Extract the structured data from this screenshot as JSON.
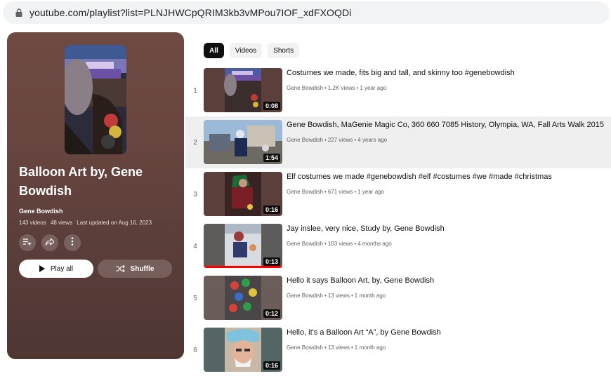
{
  "browser": {
    "url": "youtube.com/playlist?list=PLNJHWCpQRIM3kb3vMPou7IOF_xdFXOQDi"
  },
  "playlist": {
    "title": "Balloon Art by, Gene Bowdish",
    "owner": "Gene Bowdish",
    "video_count": "143 videos",
    "views": "48 views",
    "updated": "Last updated on Aug 16, 2023",
    "play_all_label": "Play all",
    "shuffle_label": "Shuffle"
  },
  "filters": [
    "All",
    "Videos",
    "Shorts"
  ],
  "videos": [
    {
      "index": "1",
      "title": "Costumes we made, fits big and tall, and skinny too #genebowdish",
      "channel": "Gene Bowdish",
      "views": "1.2K views",
      "age": "1 year ago",
      "duration": "0:08"
    },
    {
      "index": "2",
      "title": "Gene Bowdish, MaGenie Magic Co, 360 660 7085 History, Olympia, WA, Fall Arts Walk 2015",
      "channel": "Gene Bowdish",
      "views": "227 views",
      "age": "4 years ago",
      "duration": "1:54"
    },
    {
      "index": "3",
      "title": "Elf costumes we made #genebowdish #elf #costumes #we #made #christmas",
      "channel": "Gene Bowdish",
      "views": "671 views",
      "age": "1 year ago",
      "duration": "0:16"
    },
    {
      "index": "4",
      "title": "Jay inslee, very nice, Study by, Gene Bowdish",
      "channel": "Gene Bowdish",
      "views": "103 views",
      "age": "4 months ago",
      "duration": "0:13",
      "watched_fraction": 1.0
    },
    {
      "index": "5",
      "title": "Hello it says Balloon Art, by, Gene Bowdish",
      "channel": "Gene Bowdish",
      "views": "13 views",
      "age": "1 month ago",
      "duration": "0:12"
    },
    {
      "index": "6",
      "title": "Hello, it's a Balloon Art “A”, by Gene Bowdish",
      "channel": "Gene Bowdish",
      "views": "13 views",
      "age": "1 month ago",
      "duration": "0:16"
    }
  ],
  "colors": {
    "panel_bg": "#6a4640",
    "chip_active": "#0f0f0f",
    "progress": "#ff0000"
  }
}
